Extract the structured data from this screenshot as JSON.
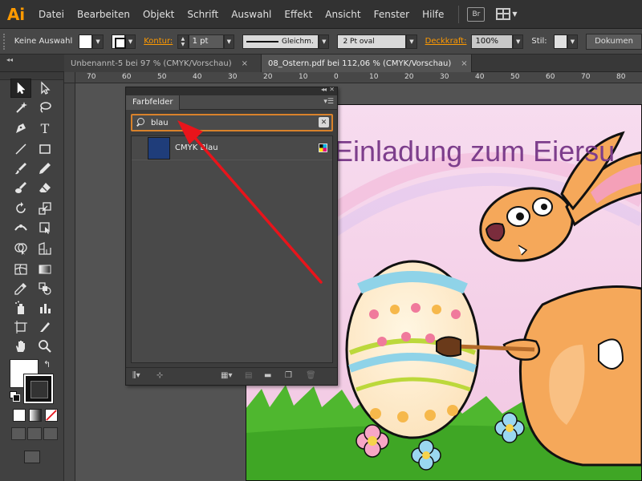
{
  "app": {
    "logo_text": "Ai",
    "menu": [
      "Datei",
      "Bearbeiten",
      "Objekt",
      "Schrift",
      "Auswahl",
      "Effekt",
      "Ansicht",
      "Fenster",
      "Hilfe"
    ],
    "bridge_label": "Br"
  },
  "controlbar": {
    "selection_status": "Keine Auswahl",
    "stroke_label": "Kontur:",
    "stroke_weight": "1 pt",
    "line_style": "Gleichm.",
    "brush_profile": "2 Pt oval",
    "opacity_label": "Deckkraft:",
    "opacity_value": "100%",
    "style_label": "Stil:",
    "document_button": "Dokumen"
  },
  "tabs": [
    {
      "label": "Unbenannt-5 bei 97 % (CMYK/Vorschau)",
      "close": "×",
      "active": false
    },
    {
      "label": "08_Ostern.pdf bei 112,06 % (CMYK/Vorschau)",
      "close": "×",
      "active": true
    }
  ],
  "ruler": {
    "labels": [
      "70",
      "60",
      "50",
      "40",
      "30",
      "20",
      "10",
      "0",
      "10",
      "20",
      "30",
      "40",
      "50",
      "60",
      "70",
      "80"
    ]
  },
  "swatches_panel": {
    "title": "Farbfelder",
    "search_value": "blau",
    "items": [
      {
        "name": "CMYK Blau",
        "color": "#1f3d7a"
      }
    ]
  },
  "artwork": {
    "title_text": "Einladung zum Eiersu"
  },
  "colors": {
    "accent_orange": "#ff9a00",
    "search_border": "#d9822b",
    "arrow_red": "#e8141b"
  },
  "icons": {
    "tools": [
      "selection-icon",
      "direct-selection-icon",
      "magic-wand-icon",
      "lasso-icon",
      "pen-icon",
      "type-icon",
      "line-segment-icon",
      "rectangle-icon",
      "paintbrush-icon",
      "pencil-icon",
      "blob-brush-icon",
      "eraser-icon",
      "rotate-icon",
      "scale-icon",
      "width-icon",
      "free-transform-icon",
      "shape-builder-icon",
      "perspective-grid-icon",
      "mesh-icon",
      "gradient-icon",
      "eyedropper-icon",
      "blend-icon",
      "symbol-sprayer-icon",
      "column-graph-icon",
      "artboard-icon",
      "slice-icon",
      "hand-icon",
      "zoom-icon"
    ]
  }
}
